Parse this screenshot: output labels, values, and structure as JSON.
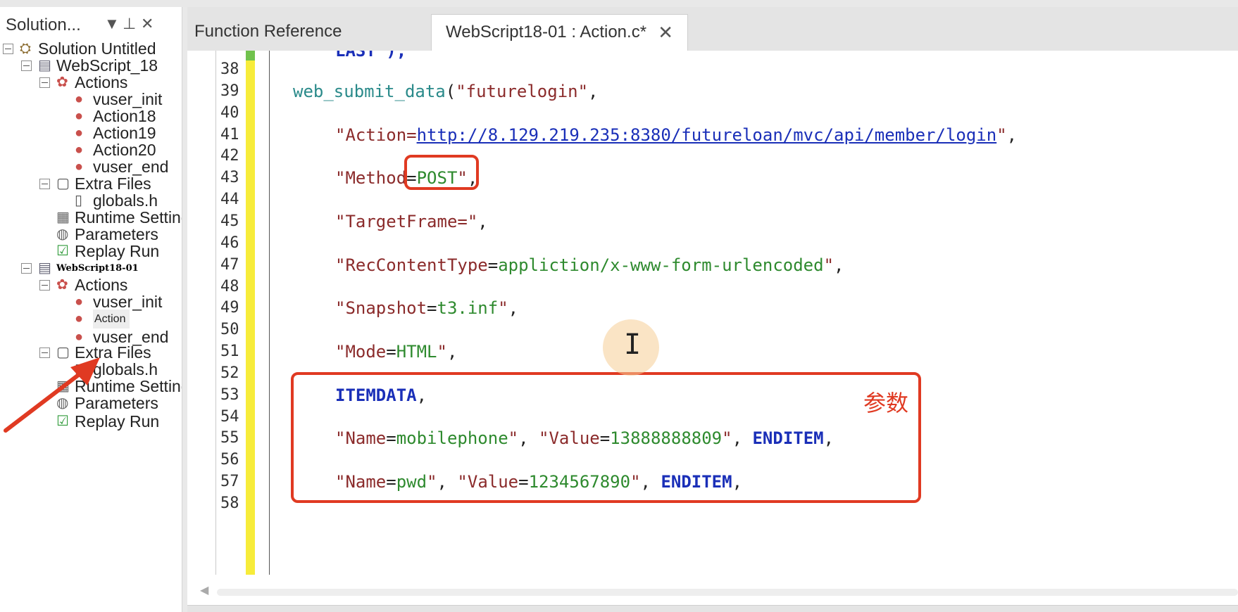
{
  "explorer": {
    "title": "Solution...",
    "controls": {
      "dropdown": "▼",
      "pin": "⊥",
      "close": "✕"
    },
    "tree": [
      {
        "label": "Solution Untitled",
        "icon": "solution-icon"
      },
      {
        "label": "WebScript_18",
        "icon": "script-icon"
      },
      {
        "label": "Actions",
        "icon": "actions-icon"
      },
      {
        "label": "vuser_init",
        "icon": "action-icon"
      },
      {
        "label": "Action18",
        "icon": "action-icon"
      },
      {
        "label": "Action19",
        "icon": "action-icon"
      },
      {
        "label": "Action20",
        "icon": "action-icon"
      },
      {
        "label": "vuser_end",
        "icon": "action-icon"
      },
      {
        "label": "Extra Files",
        "icon": "extra-files-icon"
      },
      {
        "label": "globals.h",
        "icon": "file-icon"
      },
      {
        "label": "Runtime Settings",
        "icon": "runtime-settings-icon"
      },
      {
        "label": "Parameters",
        "icon": "parameters-icon"
      },
      {
        "label": "Replay Run",
        "icon": "replay-run-icon"
      },
      {
        "label": "WebScript18-01",
        "icon": "script-icon"
      },
      {
        "label": "Actions",
        "icon": "actions-icon"
      },
      {
        "label": "vuser_init",
        "icon": "action-icon"
      },
      {
        "label": "Action",
        "icon": "action-icon"
      },
      {
        "label": "vuser_end",
        "icon": "action-icon"
      },
      {
        "label": "Extra Files",
        "icon": "extra-files-icon"
      },
      {
        "label": "globals.h",
        "icon": "file-icon"
      },
      {
        "label": "Runtime Settings",
        "icon": "runtime-settings-icon"
      },
      {
        "label": "Parameters",
        "icon": "parameters-icon"
      },
      {
        "label": "Replay Run",
        "icon": "replay-run-icon"
      }
    ]
  },
  "tabs": [
    {
      "label": "Function Reference"
    },
    {
      "label": "WebScript18-01 : Action.c*",
      "close": "✕"
    }
  ],
  "editor": {
    "partial_line": "LAST\");",
    "lines": [
      {
        "n": "38",
        "code": []
      },
      {
        "n": "39",
        "code": [
          [
            "fn",
            "web_submit_data"
          ],
          [
            "punc",
            "("
          ],
          [
            "str",
            "\"futurelogin\""
          ],
          [
            "punc",
            ","
          ]
        ]
      },
      {
        "n": "40",
        "code": []
      },
      {
        "n": "41",
        "code": [
          [
            "str",
            "\"Action="
          ],
          [
            "url",
            "http://8.129.219.235:8380/futureloan/mvc/api/member/login"
          ],
          [
            "str",
            "\""
          ],
          [
            "punc",
            ","
          ]
        ]
      },
      {
        "n": "42",
        "code": []
      },
      {
        "n": "43",
        "code": [
          [
            "str",
            "\"Method"
          ],
          [
            "punc",
            "="
          ],
          [
            "val",
            "POST"
          ],
          [
            "str",
            "\""
          ],
          [
            "punc",
            ","
          ]
        ]
      },
      {
        "n": "44",
        "code": []
      },
      {
        "n": "45",
        "code": [
          [
            "str",
            "\"TargetFrame=\""
          ],
          [
            "punc",
            ","
          ]
        ]
      },
      {
        "n": "46",
        "code": []
      },
      {
        "n": "47",
        "code": [
          [
            "str",
            "\"RecContentType"
          ],
          [
            "punc",
            "="
          ],
          [
            "val",
            "appliction/x-www-form-urlencoded"
          ],
          [
            "str",
            "\""
          ],
          [
            "punc",
            ","
          ]
        ]
      },
      {
        "n": "48",
        "code": []
      },
      {
        "n": "49",
        "code": [
          [
            "str",
            "\"Snapshot"
          ],
          [
            "punc",
            "="
          ],
          [
            "val",
            "t3.inf"
          ],
          [
            "str",
            "\""
          ],
          [
            "punc",
            ","
          ]
        ]
      },
      {
        "n": "50",
        "code": []
      },
      {
        "n": "51",
        "code": [
          [
            "str",
            "\"Mode"
          ],
          [
            "punc",
            "="
          ],
          [
            "val",
            "HTML"
          ],
          [
            "str",
            "\""
          ],
          [
            "punc",
            ","
          ]
        ]
      },
      {
        "n": "52",
        "code": []
      },
      {
        "n": "53",
        "code": [
          [
            "kw",
            "ITEMDATA"
          ],
          [
            "punc",
            ","
          ]
        ]
      },
      {
        "n": "54",
        "code": []
      },
      {
        "n": "55",
        "code": [
          [
            "str",
            "\"Name"
          ],
          [
            "punc",
            "="
          ],
          [
            "val",
            "mobilephone"
          ],
          [
            "str",
            "\""
          ],
          [
            "punc",
            ", "
          ],
          [
            "str",
            "\"Value"
          ],
          [
            "punc",
            "="
          ],
          [
            "val",
            "13888888809"
          ],
          [
            "str",
            "\""
          ],
          [
            "punc",
            ", "
          ],
          [
            "kw",
            "ENDITEM"
          ],
          [
            "punc",
            ","
          ]
        ]
      },
      {
        "n": "56",
        "code": []
      },
      {
        "n": "57",
        "code": [
          [
            "str",
            "\"Name"
          ],
          [
            "punc",
            "="
          ],
          [
            "val",
            "pwd"
          ],
          [
            "str",
            "\""
          ],
          [
            "punc",
            ", "
          ],
          [
            "str",
            "\"Value"
          ],
          [
            "punc",
            "="
          ],
          [
            "val",
            "1234567890"
          ],
          [
            "str",
            "\""
          ],
          [
            "punc",
            ", "
          ],
          [
            "kw",
            "ENDITEM"
          ],
          [
            "punc",
            ","
          ]
        ]
      },
      {
        "n": "58",
        "code": []
      }
    ]
  },
  "annotation": {
    "label": "参数",
    "color": "#e03a22"
  },
  "colors": {
    "function": "#2a8a8a",
    "string": "#8b2b2b",
    "value": "#2e8a2e",
    "keyword": "#1a2fb8"
  }
}
